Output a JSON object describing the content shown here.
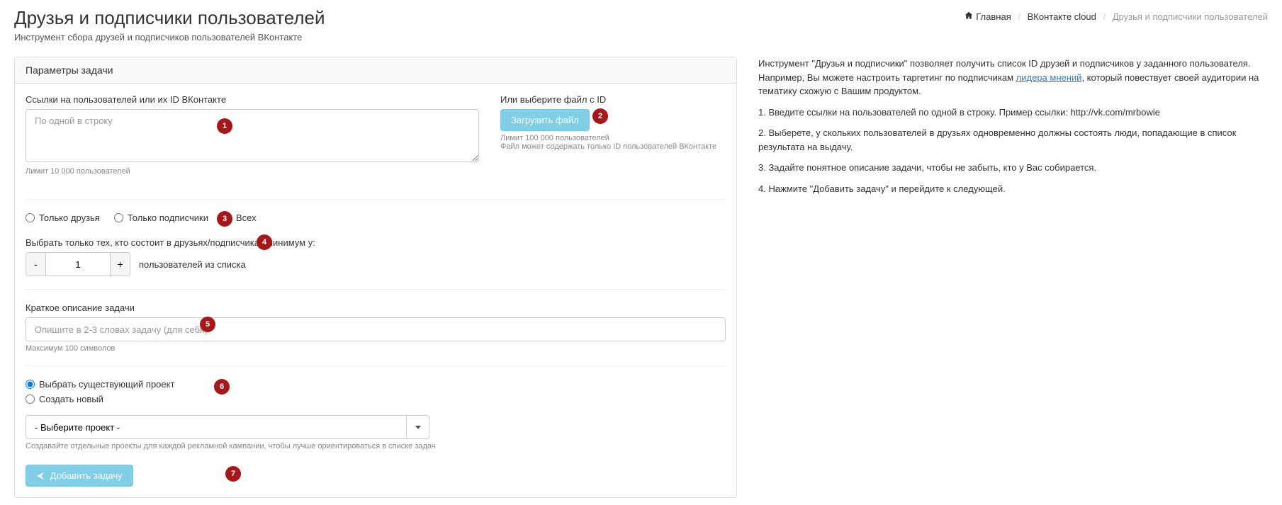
{
  "header": {
    "title": "Друзья и подписчики пользователей",
    "subtitle": "Инструмент сбора друзей и подписчиков пользователей ВКонтакте"
  },
  "breadcrumb": {
    "home": "Главная",
    "mid": "ВКонтакте cloud",
    "current": "Друзья и подписчики пользователей"
  },
  "panel": {
    "heading": "Параметры задачи"
  },
  "users": {
    "label": "Ссылки на пользователей или их ID ВКонтакте",
    "placeholder": "По одной в строку",
    "help": "Лимит 10 000 пользователей"
  },
  "file": {
    "label": "Или выберите файл с ID",
    "button": "Загрузить файл",
    "help1": "Лимит 100 000 пользователей",
    "help2": "Файл может содержать только ID пользователей ВКонтакте"
  },
  "mode": {
    "friends": "Только друзья",
    "subscribers": "Только подписчики",
    "all": "Всех"
  },
  "minimum": {
    "label": "Выбрать только тех, кто состоит в друзьях/подписчиках минимум у:",
    "value": "1",
    "suffix": "пользователей из списка"
  },
  "desc": {
    "label": "Краткое описание задачи",
    "placeholder": "Опишите в 2-3 словах задачу (для себя)",
    "help": "Максимум 100 символов"
  },
  "project": {
    "existing": "Выбрать существующий проект",
    "create": "Создать новый",
    "placeholder": "- Выберите проект -",
    "help": "Создавайте отдельные проекты для каждой рекламной кампании, чтобы лучше ориентироваться в списке задач"
  },
  "submit": {
    "label": "Добавить задачу"
  },
  "side": {
    "p1a": "Инструмент \"Друзья и подписчики\" позволяет получить список ID друзей и подписчиков у заданного пользователя. Например, Вы можете настроить таргетинг по подписчикам ",
    "p1link": "лидера мнений",
    "p1b": ", который повествует своей аудитории на тематику схожую с Вашим продуктом.",
    "p2": "1. Введите ссылки на пользователей по одной в строку. Пример ссылки: http://vk.com/mrbowie",
    "p3": "2. Выберете, у скольких пользователей в друзьях одновременно должны состоять люди, попадающие в список результата на выдачу.",
    "p4": "3. Задайте понятное описание задачи, чтобы не забыть, кто у Вас собирается.",
    "p5": "4. Нажмите \"Добавить задачу\" и перейдите к следующей."
  },
  "markers": [
    "1",
    "2",
    "3",
    "4",
    "5",
    "6",
    "7"
  ]
}
